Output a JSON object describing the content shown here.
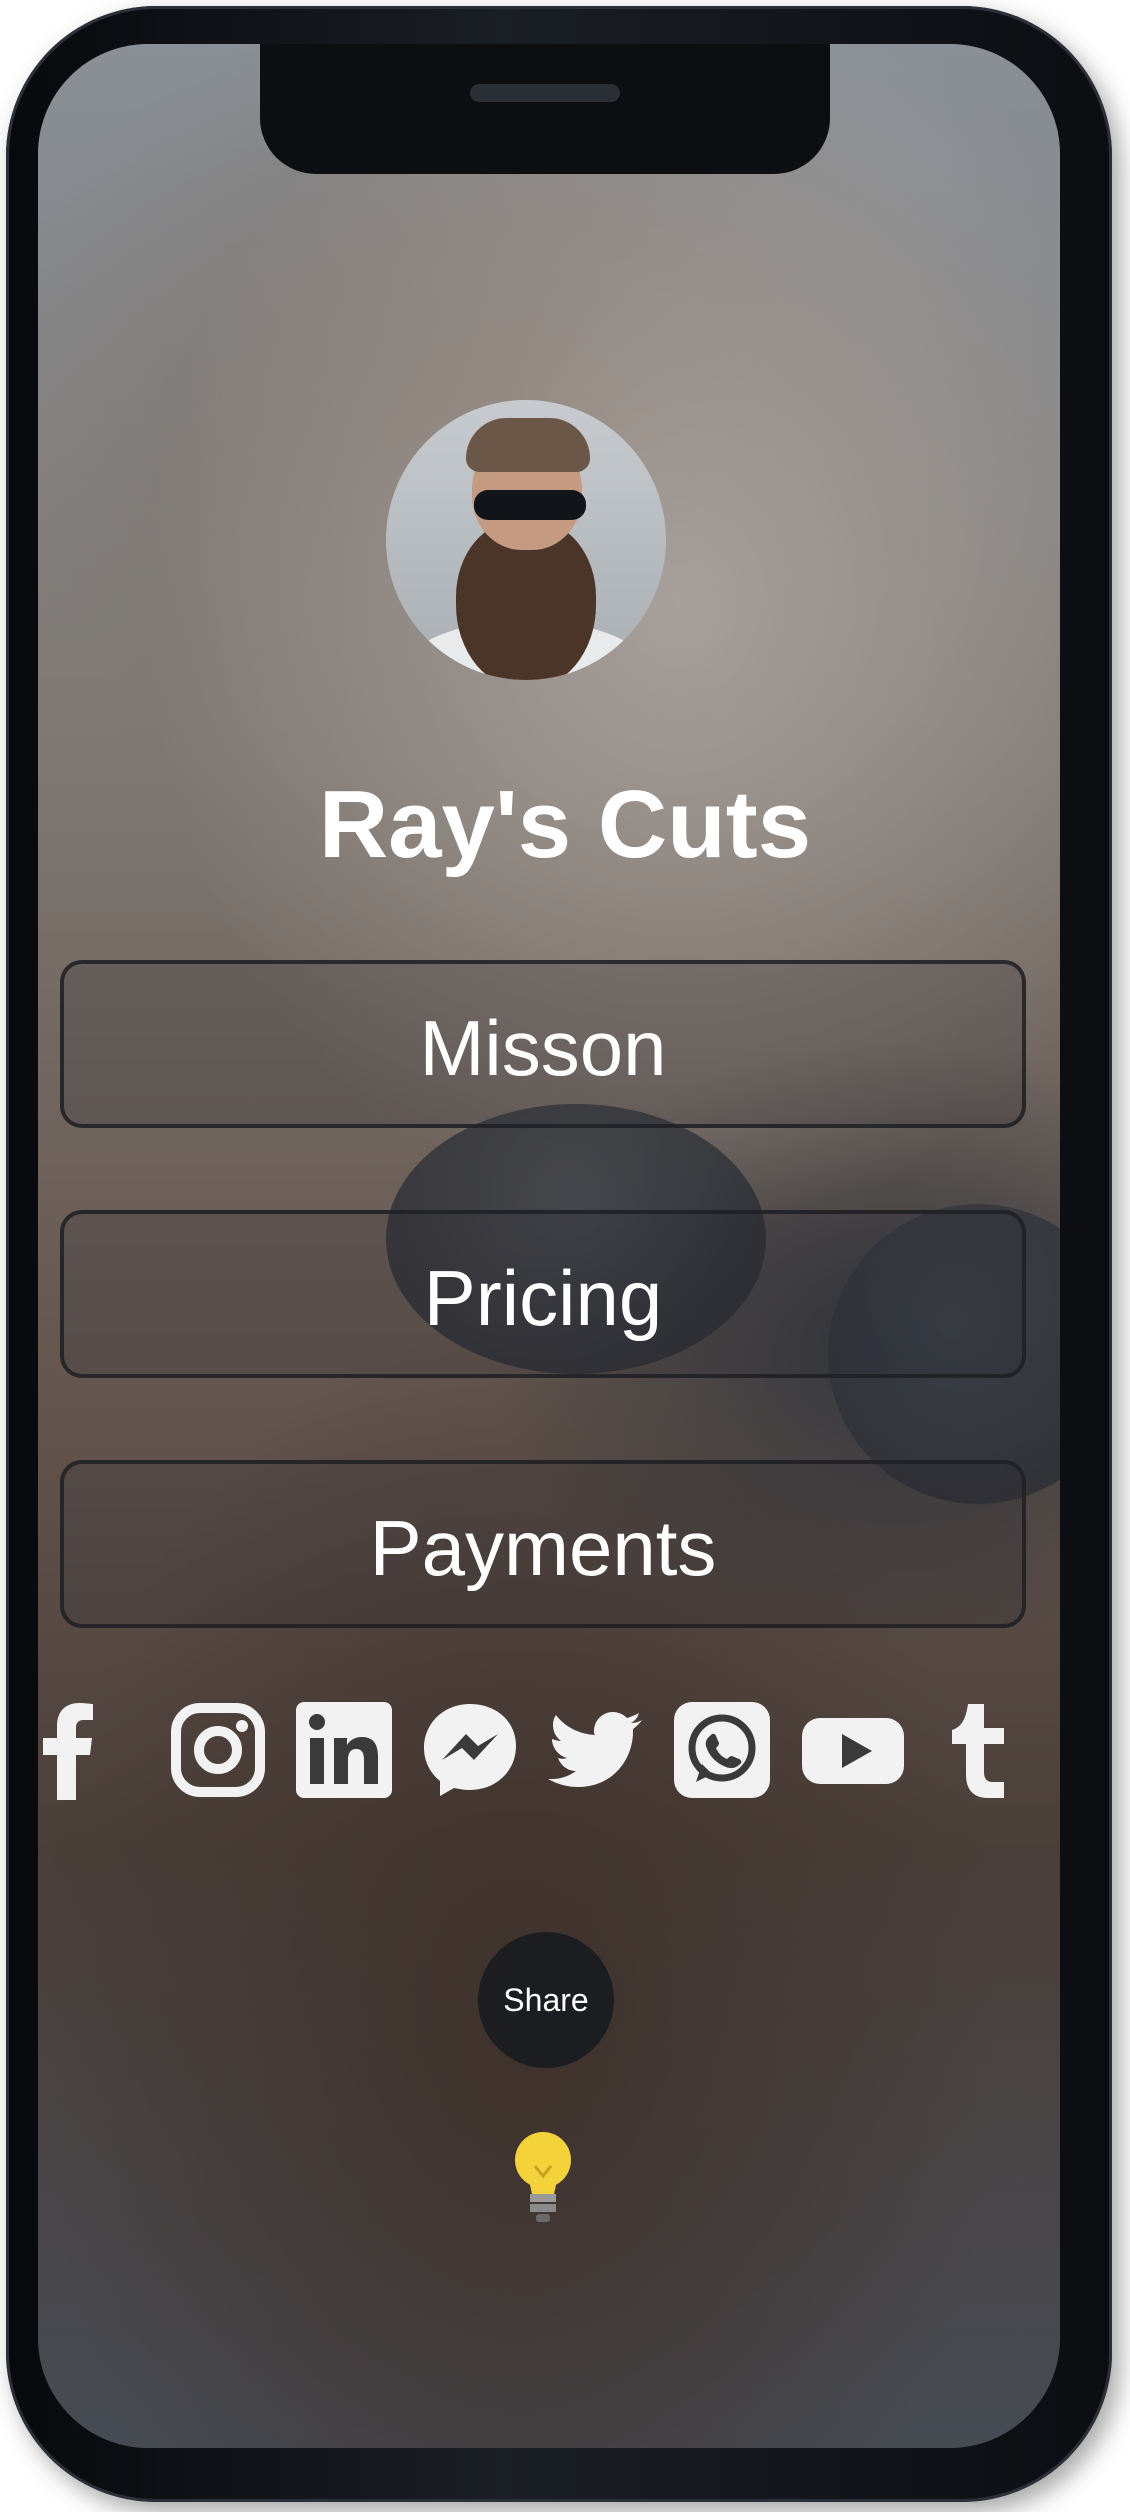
{
  "profile": {
    "name": "Ray's Cuts"
  },
  "menu": {
    "items": [
      {
        "label": "Misson"
      },
      {
        "label": "Pricing"
      },
      {
        "label": "Payments"
      }
    ]
  },
  "social": {
    "icons": [
      "facebook-icon",
      "instagram-icon",
      "linkedin-icon",
      "messenger-icon",
      "twitter-icon",
      "whatsapp-icon",
      "youtube-icon",
      "tumblr-icon"
    ]
  },
  "share": {
    "label": "Share"
  },
  "colors": {
    "text": "#ffffff",
    "button_border": "#1e2024",
    "share_bg": "#1b1d21",
    "phone_frame": "#0c0e12",
    "bulb": "#f4d23a"
  }
}
